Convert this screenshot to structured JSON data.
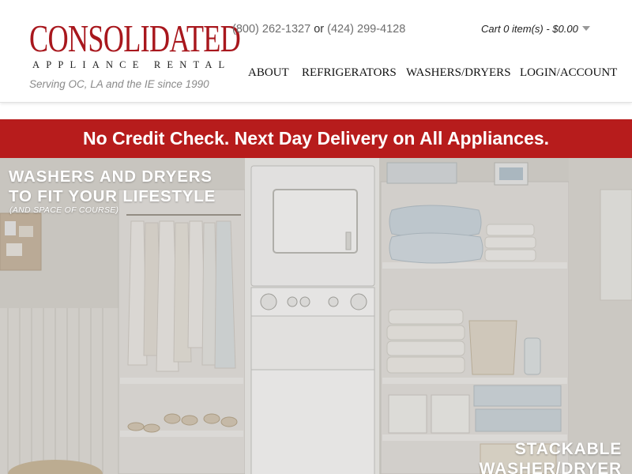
{
  "brand": {
    "name": "CONSOLIDATED",
    "subtitle": "APPLIANCE RENTAL",
    "tagline": "Serving OC, LA and the IE since 1990",
    "color": "#a8171d"
  },
  "contact": {
    "phone1": "(800) 262-1327",
    "separator": "or",
    "phone2": "(424) 299-4128"
  },
  "cart": {
    "label": "Cart 0 item(s) - $0.00",
    "icon": "chevron-down-icon"
  },
  "nav": {
    "items": [
      {
        "label": "ABOUT"
      },
      {
        "label": "REFRIGERATORS"
      },
      {
        "label": "WASHERS/DRYERS"
      },
      {
        "label": "LOGIN/ACCOUNT"
      }
    ]
  },
  "promo": {
    "text": "No Credit Check. Next Day Delivery on All Appliances.",
    "color": "#b71c1c"
  },
  "hero": {
    "title_line1": "WASHERS AND DRYERS",
    "title_line2": "TO FIT YOUR LIFESTYLE",
    "subtitle": "(AND SPACE OF COURSE)",
    "caption_line1": "STACKABLE",
    "caption_line2": "WASHER/DRYER"
  }
}
